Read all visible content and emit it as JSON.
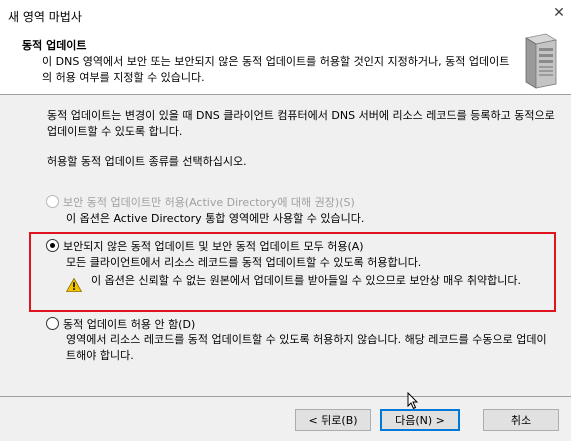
{
  "window": {
    "title": "새 영역 마법사",
    "close_label": "✕"
  },
  "header": {
    "title": "동적 업데이트",
    "subtitle": "이 DNS 영역에서 보안 또는 보안되지 않은 동적 업데이트를 허용할 것인지 지정하거나, 동적 업데이트의 허용 여부를 지정할 수 있습니다."
  },
  "body": {
    "intro": "동적 업데이트는 변경이 있을 때 DNS 클라이언트 컴퓨터에서 DNS 서버에 리소스 레코드를 등록하고 동적으로 업데이트할 수 있도록 합니다.",
    "prompt": "허용할 동적 업데이트 종류를 선택하십시오.",
    "options": [
      {
        "label": "보안 동적 업데이트만 허용(Active Directory에 대해 권장)(S)",
        "description": "이 옵션은 Active Directory 통합 영역에만 사용할 수 있습니다.",
        "checked": false,
        "disabled": true
      },
      {
        "label": "보안되지 않은 동적 업데이트 및 보안 동적 업데이트 모두 허용(A)",
        "description": "모든 클라이언트에서 리소스 레코드를 동적 업데이트할 수 있도록 허용합니다.",
        "warning": "이 옵션은 신뢰할 수 없는 원본에서 업데이트를 받아들일 수 있으므로 보안상 매우 취약합니다.",
        "checked": true,
        "disabled": false
      },
      {
        "label": "동적 업데이트 허용 안 함(D)",
        "description": "영역에서 리소스 레코드를 동적 업데이트할 수 있도록 허용하지 않습니다. 해당 레코드를 수동으로 업데이트해야 합니다.",
        "checked": false,
        "disabled": false
      }
    ]
  },
  "footer": {
    "back_label": "< 뒤로(B)",
    "next_label": "다음(N) >",
    "cancel_label": "취소"
  },
  "colors": {
    "highlight_border": "#e0141e",
    "focus_border": "#0078d7",
    "disabled_text": "#a0a0a0"
  }
}
